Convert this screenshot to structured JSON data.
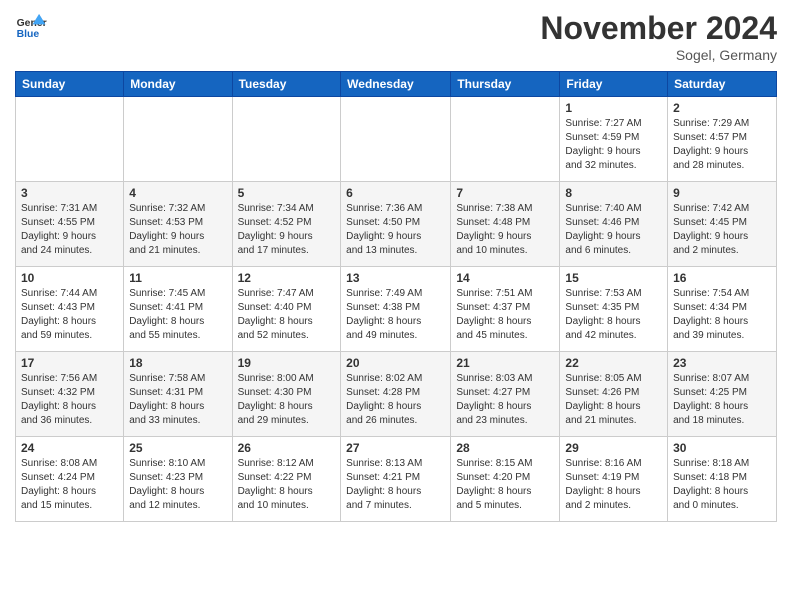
{
  "logo": {
    "line1": "General",
    "line2": "Blue"
  },
  "title": "November 2024",
  "location": "Sogel, Germany",
  "weekdays": [
    "Sunday",
    "Monday",
    "Tuesday",
    "Wednesday",
    "Thursday",
    "Friday",
    "Saturday"
  ],
  "weeks": [
    [
      {
        "day": "",
        "info": ""
      },
      {
        "day": "",
        "info": ""
      },
      {
        "day": "",
        "info": ""
      },
      {
        "day": "",
        "info": ""
      },
      {
        "day": "",
        "info": ""
      },
      {
        "day": "1",
        "info": "Sunrise: 7:27 AM\nSunset: 4:59 PM\nDaylight: 9 hours\nand 32 minutes."
      },
      {
        "day": "2",
        "info": "Sunrise: 7:29 AM\nSunset: 4:57 PM\nDaylight: 9 hours\nand 28 minutes."
      }
    ],
    [
      {
        "day": "3",
        "info": "Sunrise: 7:31 AM\nSunset: 4:55 PM\nDaylight: 9 hours\nand 24 minutes."
      },
      {
        "day": "4",
        "info": "Sunrise: 7:32 AM\nSunset: 4:53 PM\nDaylight: 9 hours\nand 21 minutes."
      },
      {
        "day": "5",
        "info": "Sunrise: 7:34 AM\nSunset: 4:52 PM\nDaylight: 9 hours\nand 17 minutes."
      },
      {
        "day": "6",
        "info": "Sunrise: 7:36 AM\nSunset: 4:50 PM\nDaylight: 9 hours\nand 13 minutes."
      },
      {
        "day": "7",
        "info": "Sunrise: 7:38 AM\nSunset: 4:48 PM\nDaylight: 9 hours\nand 10 minutes."
      },
      {
        "day": "8",
        "info": "Sunrise: 7:40 AM\nSunset: 4:46 PM\nDaylight: 9 hours\nand 6 minutes."
      },
      {
        "day": "9",
        "info": "Sunrise: 7:42 AM\nSunset: 4:45 PM\nDaylight: 9 hours\nand 2 minutes."
      }
    ],
    [
      {
        "day": "10",
        "info": "Sunrise: 7:44 AM\nSunset: 4:43 PM\nDaylight: 8 hours\nand 59 minutes."
      },
      {
        "day": "11",
        "info": "Sunrise: 7:45 AM\nSunset: 4:41 PM\nDaylight: 8 hours\nand 55 minutes."
      },
      {
        "day": "12",
        "info": "Sunrise: 7:47 AM\nSunset: 4:40 PM\nDaylight: 8 hours\nand 52 minutes."
      },
      {
        "day": "13",
        "info": "Sunrise: 7:49 AM\nSunset: 4:38 PM\nDaylight: 8 hours\nand 49 minutes."
      },
      {
        "day": "14",
        "info": "Sunrise: 7:51 AM\nSunset: 4:37 PM\nDaylight: 8 hours\nand 45 minutes."
      },
      {
        "day": "15",
        "info": "Sunrise: 7:53 AM\nSunset: 4:35 PM\nDaylight: 8 hours\nand 42 minutes."
      },
      {
        "day": "16",
        "info": "Sunrise: 7:54 AM\nSunset: 4:34 PM\nDaylight: 8 hours\nand 39 minutes."
      }
    ],
    [
      {
        "day": "17",
        "info": "Sunrise: 7:56 AM\nSunset: 4:32 PM\nDaylight: 8 hours\nand 36 minutes."
      },
      {
        "day": "18",
        "info": "Sunrise: 7:58 AM\nSunset: 4:31 PM\nDaylight: 8 hours\nand 33 minutes."
      },
      {
        "day": "19",
        "info": "Sunrise: 8:00 AM\nSunset: 4:30 PM\nDaylight: 8 hours\nand 29 minutes."
      },
      {
        "day": "20",
        "info": "Sunrise: 8:02 AM\nSunset: 4:28 PM\nDaylight: 8 hours\nand 26 minutes."
      },
      {
        "day": "21",
        "info": "Sunrise: 8:03 AM\nSunset: 4:27 PM\nDaylight: 8 hours\nand 23 minutes."
      },
      {
        "day": "22",
        "info": "Sunrise: 8:05 AM\nSunset: 4:26 PM\nDaylight: 8 hours\nand 21 minutes."
      },
      {
        "day": "23",
        "info": "Sunrise: 8:07 AM\nSunset: 4:25 PM\nDaylight: 8 hours\nand 18 minutes."
      }
    ],
    [
      {
        "day": "24",
        "info": "Sunrise: 8:08 AM\nSunset: 4:24 PM\nDaylight: 8 hours\nand 15 minutes."
      },
      {
        "day": "25",
        "info": "Sunrise: 8:10 AM\nSunset: 4:23 PM\nDaylight: 8 hours\nand 12 minutes."
      },
      {
        "day": "26",
        "info": "Sunrise: 8:12 AM\nSunset: 4:22 PM\nDaylight: 8 hours\nand 10 minutes."
      },
      {
        "day": "27",
        "info": "Sunrise: 8:13 AM\nSunset: 4:21 PM\nDaylight: 8 hours\nand 7 minutes."
      },
      {
        "day": "28",
        "info": "Sunrise: 8:15 AM\nSunset: 4:20 PM\nDaylight: 8 hours\nand 5 minutes."
      },
      {
        "day": "29",
        "info": "Sunrise: 8:16 AM\nSunset: 4:19 PM\nDaylight: 8 hours\nand 2 minutes."
      },
      {
        "day": "30",
        "info": "Sunrise: 8:18 AM\nSunset: 4:18 PM\nDaylight: 8 hours\nand 0 minutes."
      }
    ]
  ]
}
